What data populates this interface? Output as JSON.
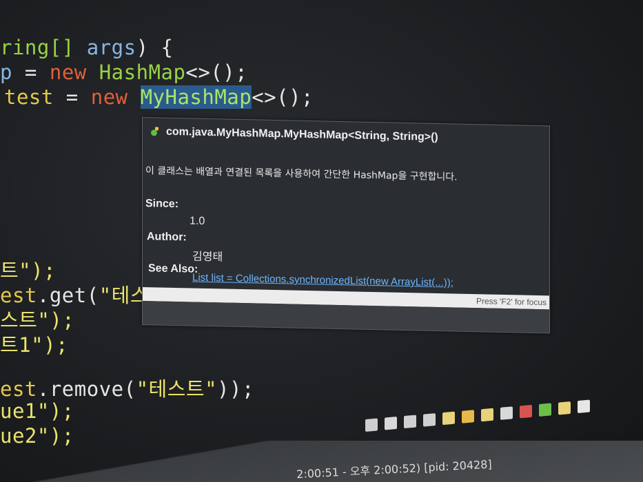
{
  "code_lines": [
    {
      "parts": [
        {
          "t": "ring[] ",
          "c": "ty"
        },
        {
          "t": "args",
          "c": "vr"
        },
        {
          "t": ") {",
          "c": "pl"
        }
      ]
    },
    {
      "parts": [
        {
          "t": "p",
          "c": "vr"
        },
        {
          "t": " = ",
          "c": "pl"
        },
        {
          "t": "new ",
          "c": "kw"
        },
        {
          "t": "HashMap",
          "c": "ty"
        },
        {
          "t": "<>();",
          "c": "pl"
        }
      ]
    },
    {
      "parts": [
        {
          "t": "test",
          "c": "id"
        },
        {
          "t": " = ",
          "c": "pl"
        },
        {
          "t": "new ",
          "c": "kw"
        },
        {
          "t": "MyHashMap",
          "c": "sel"
        },
        {
          "t": "<>();",
          "c": "pl"
        }
      ]
    },
    {
      "parts": [
        {
          "t": "트\");",
          "c": "st"
        }
      ]
    },
    {
      "parts": [
        {
          "t": "est",
          "c": "id"
        },
        {
          "t": ".get(",
          "c": "pl"
        },
        {
          "t": "\"테스트",
          "c": "st"
        }
      ]
    },
    {
      "parts": [
        {
          "t": "스트\");",
          "c": "st"
        }
      ]
    },
    {
      "parts": [
        {
          "t": "트1\");",
          "c": "st"
        }
      ]
    },
    {
      "parts": [
        {
          "t": "est",
          "c": "id"
        },
        {
          "t": ".remove(",
          "c": "pl"
        },
        {
          "t": "\"테스트\"",
          "c": "st"
        },
        {
          "t": "));",
          "c": "pl"
        }
      ]
    },
    {
      "parts": [
        {
          "t": "ue1\");",
          "c": "st"
        }
      ]
    },
    {
      "parts": [
        {
          "t": "ue2\");",
          "c": "st"
        }
      ]
    }
  ],
  "tooltip": {
    "signature": "com.java.MyHashMap.MyHashMap<String, String>()",
    "description": "이 클래스는 배열과 연결된 목록을 사용하여 간단한 HashMap을 구현합니다.",
    "since_label": "Since:",
    "since_value": "1.0",
    "author_label": "Author:",
    "author_value": "김영태",
    "see_also_label": "See Also:",
    "see_also_link": "List list = Collections.synchronizedList(new ArrayList(...));",
    "focus_hint": "Press 'F2' for focus",
    "icon": "constructor-icon"
  },
  "status_text": "2:00:51 - 오후 2:00:52) [pid: 20428]",
  "toolbar_icons": [
    "sync-icon",
    "stop-icon",
    "close-icon",
    "close-all-icon",
    "doc-icon",
    "doc-icon",
    "doc-icon",
    "doc-icon",
    "doc-icon",
    "doc-icon",
    "doc-icon",
    "doc-icon"
  ]
}
